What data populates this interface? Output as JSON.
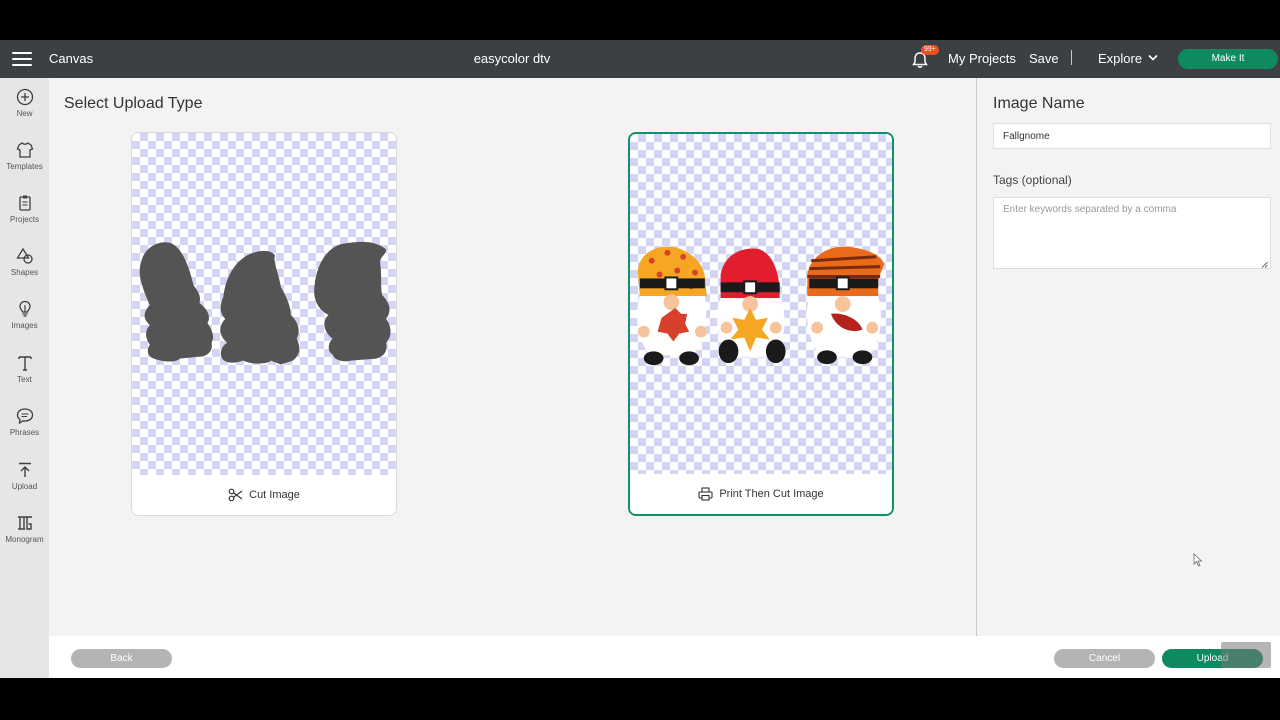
{
  "topbar": {
    "menu_label": "",
    "section": "Canvas",
    "title": "easycolor dtv",
    "notifications_badge": "99+",
    "my_projects": "My Projects",
    "save": "Save",
    "explore": "Explore",
    "make_it": "Make It"
  },
  "sidebar": {
    "items": [
      {
        "label": "New",
        "icon": "plus-circle-icon"
      },
      {
        "label": "Templates",
        "icon": "shirt-icon"
      },
      {
        "label": "Projects",
        "icon": "clipboard-icon"
      },
      {
        "label": "Shapes",
        "icon": "shapes-icon"
      },
      {
        "label": "Images",
        "icon": "lightbulb-icon"
      },
      {
        "label": "Text",
        "icon": "text-icon"
      },
      {
        "label": "Phrases",
        "icon": "speech-bubble-icon"
      },
      {
        "label": "Upload",
        "icon": "upload-icon"
      },
      {
        "label": "Monogram",
        "icon": "monogram-icon"
      }
    ]
  },
  "main": {
    "title": "Select Upload Type",
    "cards": [
      {
        "label": "Cut Image",
        "icon": "scissors-icon",
        "selected": false
      },
      {
        "label": "Print Then Cut Image",
        "icon": "printer-icon",
        "selected": true
      }
    ]
  },
  "right_panel": {
    "image_name_label": "Image Name",
    "image_name_value": "Fallgnome",
    "tags_label": "Tags (optional)",
    "tags_placeholder": "Enter keywords separated by a comma"
  },
  "bottombar": {
    "back": "Back",
    "cancel": "Cancel",
    "upload": "Upload"
  },
  "colors": {
    "topbar": "#3c3f44",
    "accent_green": "#0f8a5f",
    "selected_border": "#11906a",
    "badge": "#e8521e",
    "disabled_button": "#b4b4b4"
  }
}
